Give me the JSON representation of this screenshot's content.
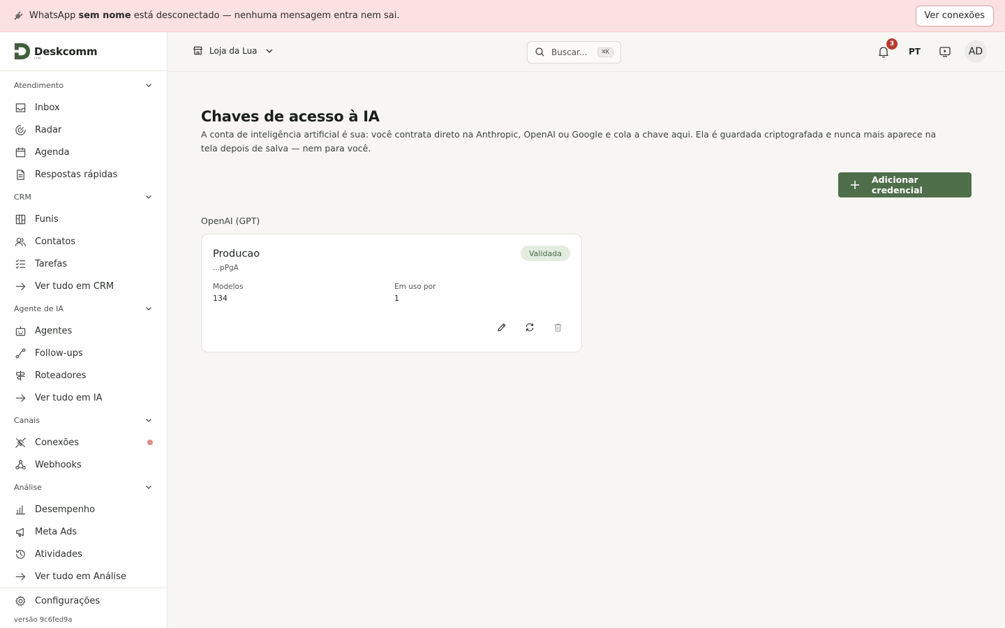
{
  "banner": {
    "prefix": "WhatsApp ",
    "bold": "sem nome",
    "suffix": " está desconectado — nenhuma mensagem entra nem sai.",
    "button": "Ver conexões",
    "icon": "plug-icon"
  },
  "brand": {
    "name": "Deskcomm",
    "sub": "CRM"
  },
  "sidebar": {
    "sections": [
      {
        "label": "Atendimento",
        "items": [
          {
            "label": "Inbox",
            "icon": "inbox-icon"
          },
          {
            "label": "Radar",
            "icon": "radar-icon"
          },
          {
            "label": "Agenda",
            "icon": "calendar-icon"
          },
          {
            "label": "Respostas rápidas",
            "icon": "document-icon"
          }
        ]
      },
      {
        "label": "CRM",
        "items": [
          {
            "label": "Funis",
            "icon": "kanban-icon"
          },
          {
            "label": "Contatos",
            "icon": "users-icon"
          },
          {
            "label": "Tarefas",
            "icon": "checklist-icon"
          },
          {
            "label": "Ver tudo em CRM",
            "icon": "arrow-right-icon"
          }
        ]
      },
      {
        "label": "Agente de IA",
        "items": [
          {
            "label": "Agentes",
            "icon": "bot-icon"
          },
          {
            "label": "Follow-ups",
            "icon": "route-icon"
          },
          {
            "label": "Roteadores",
            "icon": "signpost-icon"
          },
          {
            "label": "Ver tudo em IA",
            "icon": "arrow-right-icon"
          }
        ]
      },
      {
        "label": "Canais",
        "items": [
          {
            "label": "Conexões",
            "icon": "unplug-icon",
            "status_color": "#e08a8a"
          },
          {
            "label": "Webhooks",
            "icon": "webhook-icon"
          }
        ]
      },
      {
        "label": "Análise",
        "items": [
          {
            "label": "Desempenho",
            "icon": "bar-chart-icon"
          },
          {
            "label": "Meta Ads",
            "icon": "megaphone-icon"
          },
          {
            "label": "Atividades",
            "icon": "history-icon"
          },
          {
            "label": "Ver tudo em Análise",
            "icon": "arrow-right-icon"
          }
        ]
      }
    ],
    "settings": "Configurações",
    "version": "versão 9c6fed9a"
  },
  "topbar": {
    "store": "Loja da Lua",
    "search_placeholder": "Buscar...",
    "search_shortcut": "⌘K",
    "notifications": "3",
    "language": "PT",
    "avatar": "AD"
  },
  "main": {
    "title": "Chaves de acesso à IA",
    "description": "A conta de inteligência artificial é sua: você contrata direto na Anthropic, OpenAI ou Google e cola a chave aqui. Ela é guardada criptografada e nunca mais aparece na tela depois de salva — nem para você.",
    "add_button": "Adicionar credencial",
    "provider": "OpenAI (GPT)",
    "credential": {
      "name": "Producao",
      "key_suffix": "...pPgA",
      "status": "Validada",
      "models_label": "Modelos",
      "models_value": "134",
      "usage_label": "Em uso por",
      "usage_value": "1"
    }
  },
  "colors": {
    "accent": "#4f6e4a",
    "banner_bg": "#fbe1e1",
    "badge": "#b63b30"
  }
}
